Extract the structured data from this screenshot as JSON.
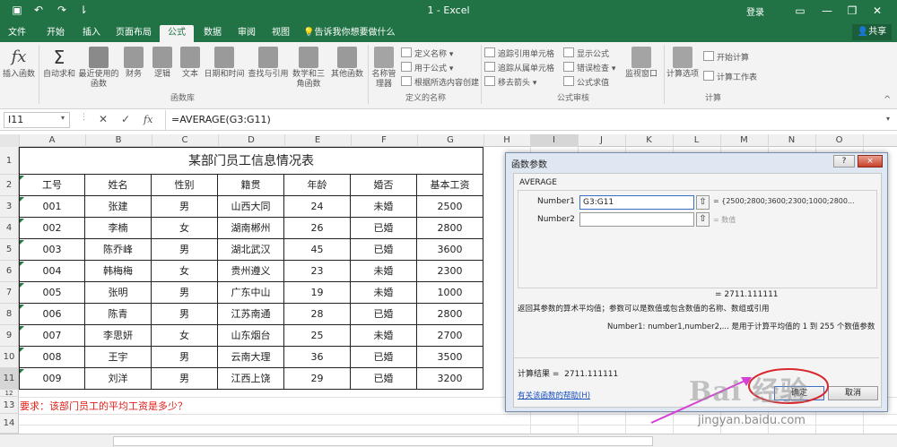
{
  "window": {
    "title": "1  -  Excel",
    "login": "登录",
    "share": "共享"
  },
  "tabs": [
    "文件",
    "开始",
    "插入",
    "页面布局",
    "公式",
    "数据",
    "审阅",
    "视图"
  ],
  "tell_me": "告诉我你想要做什么",
  "ribbon": {
    "insert_function": "插入函数",
    "autosum": "自动求和",
    "recent": "最近使用的函数",
    "finance": "财务",
    "logic": "逻辑",
    "text": "文本",
    "datetime": "日期和时间",
    "lookup": "查找与引用",
    "math": "数学和三角函数",
    "other": "其他函数",
    "name_manager": "名称管理器",
    "define_name": "定义名称",
    "use_in_formula": "用于公式",
    "create_from_selection": "根据所选内容创建",
    "trace_precedents": "追踪引用单元格",
    "trace_dependents": "追踪从属单元格",
    "remove_arrows": "移去箭头",
    "show_formulas": "显示公式",
    "error_checking": "错误检查",
    "evaluate_formula": "公式求值",
    "watch_window": "监视窗口",
    "calc_options": "计算选项",
    "calc_now": "开始计算",
    "calc_sheet": "计算工作表",
    "group_library": "函数库",
    "group_names": "定义的名称",
    "group_audit": "公式审核",
    "group_calc": "计算"
  },
  "formula_bar": {
    "name_box": "I11",
    "fx": "fx",
    "formula": "=AVERAGE(G3:G11)"
  },
  "columns": [
    "A",
    "B",
    "C",
    "D",
    "E",
    "F",
    "G",
    "H",
    "I",
    "J",
    "K",
    "L",
    "M",
    "N",
    "O"
  ],
  "rows": [
    "1",
    "2",
    "3",
    "4",
    "5",
    "6",
    "7",
    "8",
    "9",
    "10",
    "11",
    "12",
    "13",
    "14"
  ],
  "sheet": {
    "title": "某部门员工信息情况表",
    "headers": [
      "工号",
      "姓名",
      "性别",
      "籍贯",
      "年龄",
      "婚否",
      "基本工资"
    ],
    "records": [
      [
        "001",
        "张建",
        "男",
        "山西大同",
        "24",
        "未婚",
        "2500"
      ],
      [
        "002",
        "李楠",
        "女",
        "湖南郴州",
        "26",
        "已婚",
        "2800"
      ],
      [
        "003",
        "陈乔峰",
        "男",
        "湖北武汉",
        "45",
        "已婚",
        "3600"
      ],
      [
        "004",
        "韩梅梅",
        "女",
        "贵州遵义",
        "23",
        "未婚",
        "2300"
      ],
      [
        "005",
        "张明",
        "男",
        "广东中山",
        "19",
        "未婚",
        "1000"
      ],
      [
        "006",
        "陈青",
        "男",
        "江苏南通",
        "28",
        "已婚",
        "2800"
      ],
      [
        "007",
        "李思妍",
        "女",
        "山东烟台",
        "25",
        "未婚",
        "2700"
      ],
      [
        "008",
        "王宇",
        "男",
        "云南大理",
        "36",
        "已婚",
        "3500"
      ],
      [
        "009",
        "刘洋",
        "男",
        "江西上饶",
        "29",
        "已婚",
        "3200"
      ]
    ],
    "note": "要求：该部门员工的平均工资是多少？"
  },
  "dialog": {
    "title": "函数参数",
    "help_q": "?",
    "close": "×",
    "func_name": "AVERAGE",
    "arg1_label": "Number1",
    "arg1_value": "G3:G11",
    "arg1_result": "= {2500;2800;3600;2300;1000;2800...",
    "arg2_label": "Number2",
    "arg2_value": "",
    "arg2_result": "= 数值",
    "result_line": "=  2711.111111",
    "description": "返回其参数的算术平均值；参数可以是数值或包含数值的名称、数组或引用",
    "arg_desc": "Number1:  number1,number2,... 是用于计算平均值的 1 到 255 个数值参数",
    "calc_result_label": "计算结果 =",
    "calc_result_value": "2711.111111",
    "help_link": "有关该函数的帮助(H)",
    "ok": "确定",
    "cancel": "取消"
  },
  "watermark": {
    "brand": "Bai 经验",
    "url": "jingyan.baidu.com"
  },
  "colors": {
    "excel_green": "#217346",
    "note_red": "#e0201a",
    "highlight_red": "#d9272e",
    "arrow_magenta": "#d63fd3",
    "link_blue": "#1a4fbf"
  }
}
